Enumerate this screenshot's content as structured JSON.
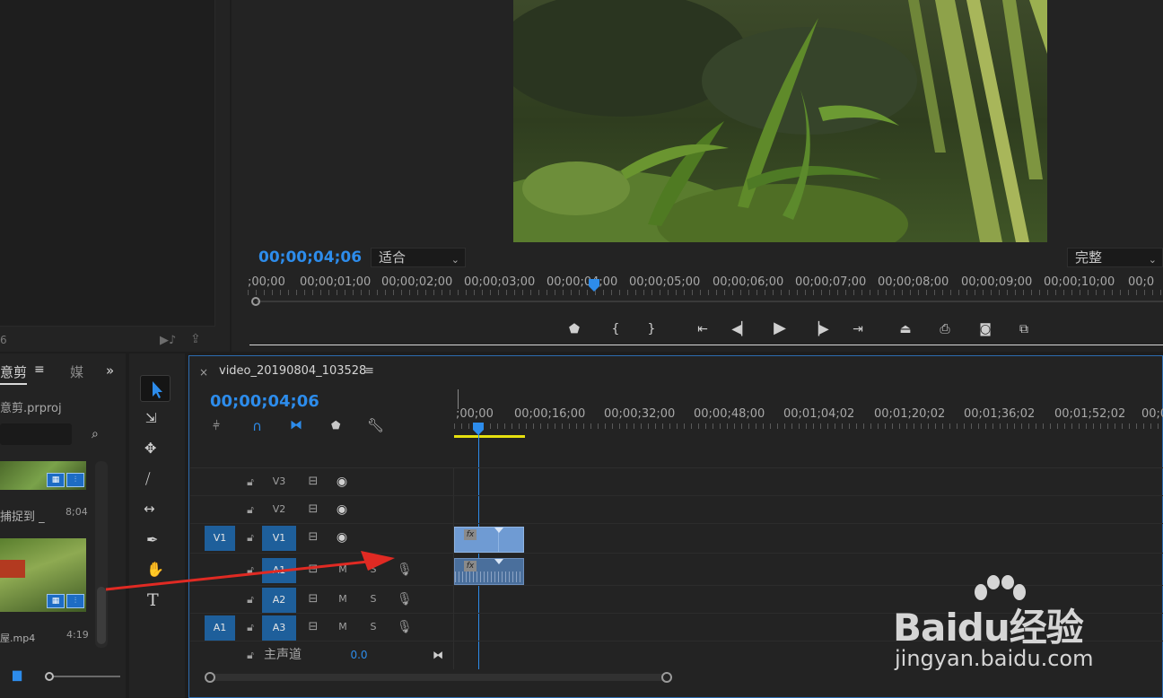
{
  "program_monitor": {
    "timecode": "00;00;04;06",
    "fit_dropdown": "适合",
    "quality_dropdown": "完整",
    "ruler_labels": [
      ";00;00",
      "00;00;01;00",
      "00;00;02;00",
      "00;00;03;00",
      "00;00;04;00",
      "00;00;05;00",
      "00;00;06;00",
      "00;00;07;00",
      "00;00;08;00",
      "00;00;09;00",
      "00;00;10;00",
      "00;0"
    ]
  },
  "project_panel": {
    "tab_label": "意剪",
    "tab2_label": "媒",
    "project_file": "意剪.prproj",
    "clip1_name": "捕捉到 _",
    "clip1_duration": "8;04",
    "clip2_name": "屋.mp4",
    "clip2_duration": "4:19",
    "source_num": "6"
  },
  "timeline": {
    "sequence_name": "video_20190804_103528",
    "timecode": "00;00;04;06",
    "ruler_labels": [
      ";00;00",
      "00;00;16;00",
      "00;00;32;00",
      "00;00;48;00",
      "00;01;04;02",
      "00;01;20;02",
      "00;01;36;02",
      "00;01;52;02",
      "00;0"
    ],
    "tracks": {
      "v3": "V3",
      "v2": "V2",
      "v1_source": "V1",
      "v1": "V1",
      "a1": "A1",
      "a2": "A2",
      "a1_source": "A1",
      "a3": "A3",
      "m": "M",
      "s": "S"
    },
    "master_label": "主声道",
    "master_value": "0.0",
    "fx": "fx"
  },
  "watermark": {
    "brand": "Baidu经验",
    "url": "jingyan.baidu.com"
  },
  "colors": {
    "accent_blue": "#2d8ceb",
    "clip_video": "#6f9bd3",
    "clip_audio": "#4a6f9c",
    "arrow_red": "#e02a23",
    "work_area_yellow": "#e6e00f"
  }
}
